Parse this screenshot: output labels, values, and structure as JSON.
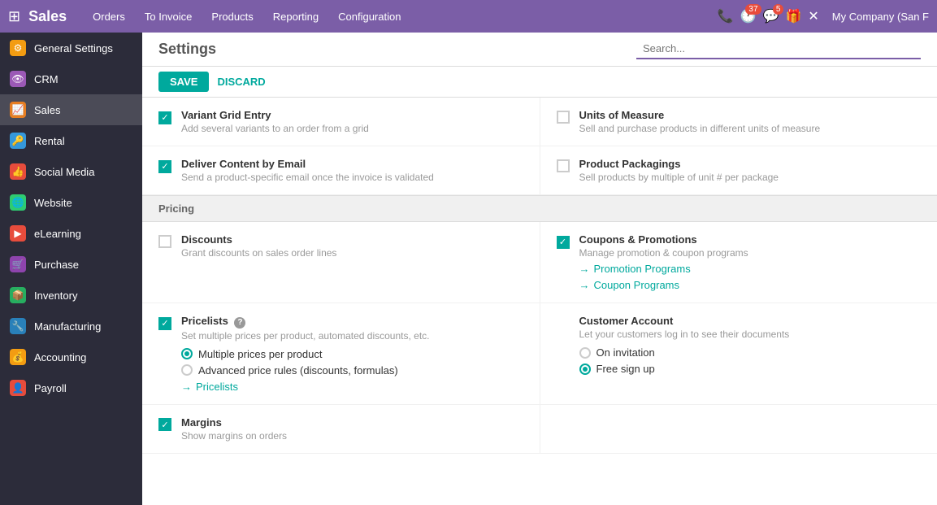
{
  "app": {
    "title": "Sales",
    "grid_icon": "⊞"
  },
  "nav": {
    "items": [
      {
        "label": "Orders"
      },
      {
        "label": "To Invoice"
      },
      {
        "label": "Products"
      },
      {
        "label": "Reporting"
      },
      {
        "label": "Configuration"
      }
    ]
  },
  "top_right": {
    "phone_icon": "📞",
    "clock_icon": "🕐",
    "clock_badge": "37",
    "chat_icon": "💬",
    "chat_badge": "5",
    "gift_icon": "🎁",
    "close_icon": "✕",
    "company": "My Company (San F"
  },
  "settings": {
    "title": "Settings",
    "search_placeholder": "Search...",
    "save_label": "SAVE",
    "discard_label": "DISCARD"
  },
  "sidebar": {
    "items": [
      {
        "label": "General Settings",
        "icon": "⚙",
        "color": "#f39c12",
        "active": false
      },
      {
        "label": "CRM",
        "icon": "👁",
        "color": "#9b59b6",
        "active": false
      },
      {
        "label": "Sales",
        "icon": "📈",
        "color": "#e67e22",
        "active": true
      },
      {
        "label": "Rental",
        "icon": "🔑",
        "color": "#3498db",
        "active": false
      },
      {
        "label": "Social Media",
        "icon": "👍",
        "color": "#e74c3c",
        "active": false
      },
      {
        "label": "Website",
        "icon": "🌐",
        "color": "#2ecc71",
        "active": false
      },
      {
        "label": "eLearning",
        "icon": "▶",
        "color": "#e74c3c",
        "active": false
      },
      {
        "label": "Purchase",
        "icon": "🛒",
        "color": "#8e44ad",
        "active": false
      },
      {
        "label": "Inventory",
        "icon": "📦",
        "color": "#27ae60",
        "active": false
      },
      {
        "label": "Manufacturing",
        "icon": "🔧",
        "color": "#2980b9",
        "active": false
      },
      {
        "label": "Accounting",
        "icon": "💰",
        "color": "#f39c12",
        "active": false
      },
      {
        "label": "Payroll",
        "icon": "👤",
        "color": "#e74c3c",
        "active": false
      }
    ]
  },
  "content": {
    "sections": [
      {
        "type": "features_row",
        "cols": [
          {
            "checked": true,
            "title": "Variant Grid Entry",
            "desc": "Add several variants to an order from a grid"
          },
          {
            "checked": false,
            "title": "Units of Measure",
            "desc": "Sell and purchase products in different units of measure"
          }
        ]
      },
      {
        "type": "features_row",
        "cols": [
          {
            "checked": true,
            "title": "Deliver Content by Email",
            "desc": "Send a product-specific email once the invoice is validated"
          },
          {
            "checked": false,
            "title": "Product Packagings",
            "desc": "Sell products by multiple of unit # per package"
          }
        ]
      },
      {
        "type": "divider",
        "label": "Pricing"
      },
      {
        "type": "pricing_row",
        "left": {
          "checked": false,
          "title": "Discounts",
          "desc": "Grant discounts on sales order lines"
        },
        "right": {
          "checked": true,
          "title": "Coupons & Promotions",
          "desc": "Manage promotion & coupon programs",
          "links": [
            {
              "label": "Promotion Programs"
            },
            {
              "label": "Coupon Programs"
            }
          ]
        }
      },
      {
        "type": "pricing_row_extended",
        "left": {
          "checked": true,
          "title": "Pricelists",
          "has_help": true,
          "desc": "Set multiple prices per product, automated discounts, etc.",
          "radios": [
            {
              "label": "Multiple prices per product",
              "selected": true
            },
            {
              "label": "Advanced price rules (discounts, formulas)",
              "selected": false
            }
          ],
          "link": "Pricelists"
        },
        "right": {
          "title": "Customer Account",
          "desc": "Let your customers log in to see their documents",
          "radios": [
            {
              "label": "On invitation",
              "selected": false
            },
            {
              "label": "Free sign up",
              "selected": true
            }
          ]
        }
      },
      {
        "type": "features_row",
        "cols": [
          {
            "checked": true,
            "title": "Margins",
            "desc": "Show margins on orders"
          },
          {
            "checked": false,
            "title": "",
            "desc": ""
          }
        ]
      }
    ]
  }
}
